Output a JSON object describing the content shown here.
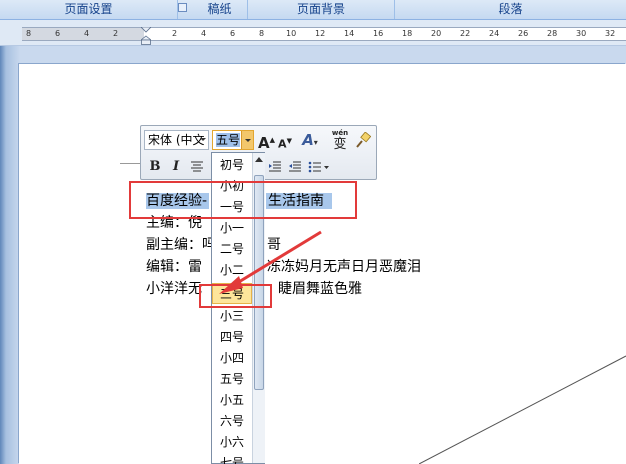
{
  "ribbon": {
    "groups": [
      "页面设置",
      "稿纸",
      "页面背景",
      "段落"
    ]
  },
  "ruler": {
    "ticks": [
      "8",
      "6",
      "4",
      "2",
      "2",
      "4",
      "6",
      "8",
      "10",
      "12",
      "14",
      "16",
      "18",
      "20",
      "22",
      "24",
      "26",
      "28",
      "30",
      "32"
    ]
  },
  "document": {
    "lines": [
      {
        "left": "百度经验",
        "right": "生活指南"
      },
      {
        "text": "主编：倪"
      },
      {
        "text": "副主编：吗",
        "tail": "哥"
      },
      {
        "text": "编辑：雷",
        "tail": "冻冻妈月无声日月恶魔泪"
      },
      {
        "text": "小洋洋无",
        "tail": "睫眉舞蓝色雅"
      }
    ]
  },
  "mini_toolbar": {
    "font_name": "宋体 (中文",
    "font_size": "五号",
    "grow_icon": "A",
    "shrink_icon": "A",
    "style_icon": "A",
    "pinyin_label": "wén",
    "pinyin_char": "变",
    "bold": "B",
    "italic": "I"
  },
  "size_dropdown": {
    "items": [
      "初号",
      "小初",
      "一号",
      "小一",
      "二号",
      "小二",
      "三号",
      "小三",
      "四号",
      "小四",
      "五号",
      "小五",
      "六号",
      "小六",
      "七号"
    ],
    "highlighted": "三号"
  }
}
